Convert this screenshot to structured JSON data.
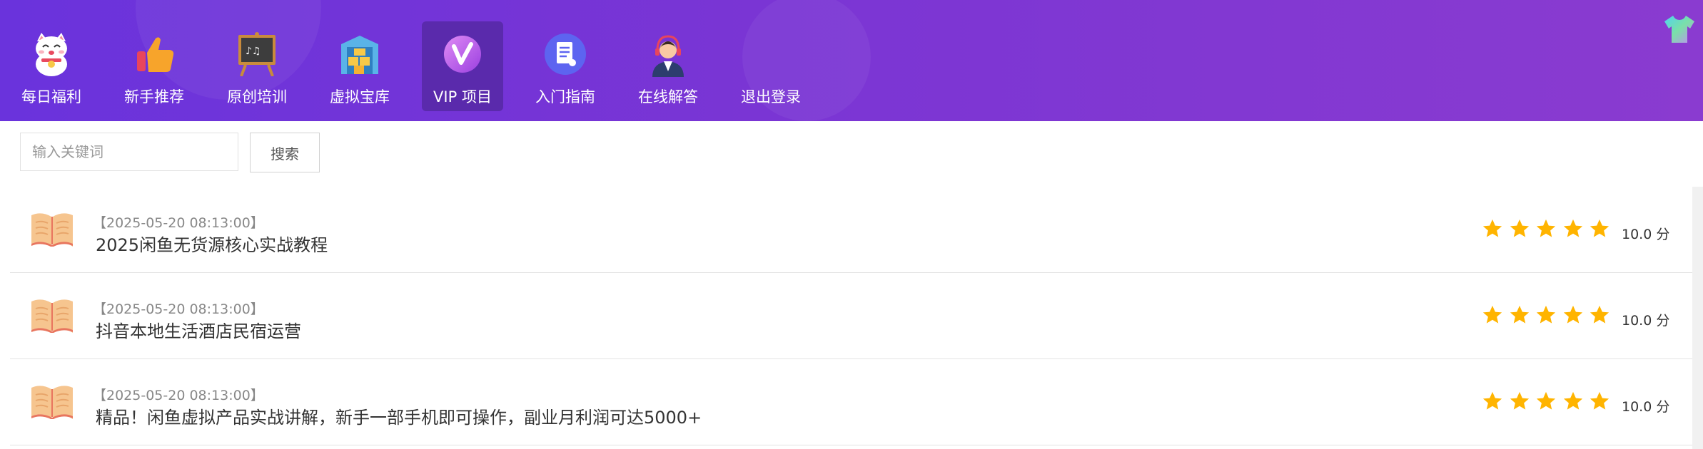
{
  "nav": {
    "items": [
      {
        "label": "每日福利",
        "icon": "lucky-cat-icon"
      },
      {
        "label": "新手推荐",
        "icon": "thumbs-up-icon"
      },
      {
        "label": "原创培训",
        "icon": "chalkboard-icon"
      },
      {
        "label": "虚拟宝库",
        "icon": "treasure-warehouse-icon"
      },
      {
        "label": "VIP 项目",
        "icon": "vip-badge-icon"
      },
      {
        "label": "入门指南",
        "icon": "document-icon"
      },
      {
        "label": "在线解答",
        "icon": "support-agent-icon"
      },
      {
        "label": "退出登录",
        "icon": ""
      }
    ],
    "active_index": 4
  },
  "skin_icon": "t-shirt-icon",
  "search": {
    "placeholder": "输入关键词",
    "button_label": "搜索"
  },
  "list": {
    "items": [
      {
        "date": "【2025-05-20 08:13:00】",
        "title": "2025闲鱼无货源核心实战教程",
        "rating": 5,
        "score": "10.0 分"
      },
      {
        "date": "【2025-05-20 08:13:00】",
        "title": "抖音本地生活酒店民宿运营",
        "rating": 5,
        "score": "10.0 分"
      },
      {
        "date": "【2025-05-20 08:13:00】",
        "title": "精品！闲鱼虚拟产品实战讲解，新手一部手机即可操作，副业月利润可达5000+",
        "rating": 5,
        "score": "10.0 分"
      }
    ]
  },
  "colors": {
    "header_start": "#6a33dc",
    "header_end": "#8a3bd0",
    "star": "#ffb400",
    "book": "#f6c58f"
  }
}
